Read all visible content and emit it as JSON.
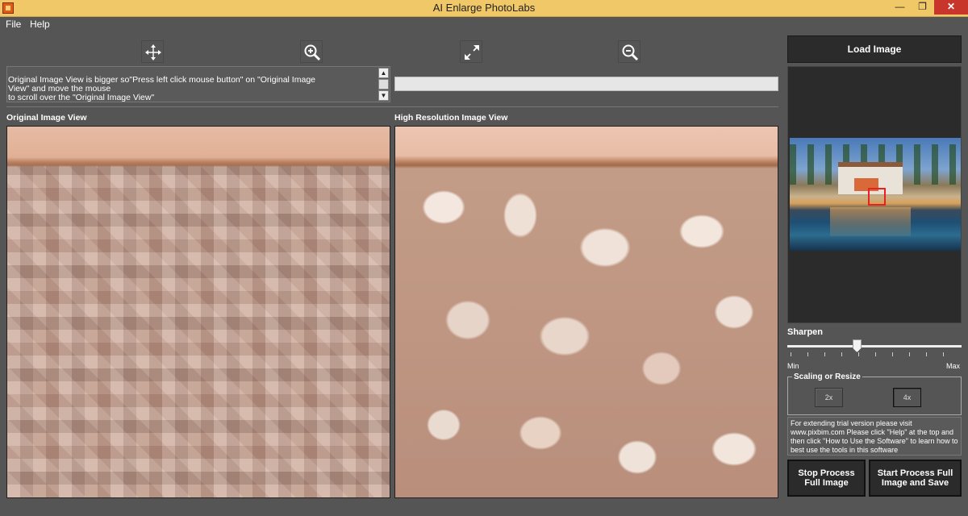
{
  "window": {
    "title": "AI Enlarge PhotoLabs",
    "min_glyph": "—",
    "max_glyph": "❐",
    "close_glyph": "✕"
  },
  "menu": [
    {
      "label": "File"
    },
    {
      "label": "Help"
    }
  ],
  "toolbar": {
    "icons": [
      "move-icon",
      "zoom-in-icon",
      "fit-expand-icon",
      "zoom-out-icon"
    ]
  },
  "info": {
    "text": "Original Image View is bigger so\"Press left click mouse button\" on \"Original Image\nView\" and move the mouse\nto scroll over the \"Original Image View\"",
    "scroll_up": "▲",
    "scroll_down": "▼"
  },
  "progress": {
    "value": 0
  },
  "views": {
    "original_label": "Original Image View",
    "hires_label": "High Resolution Image View"
  },
  "right_panel": {
    "load_button": "Load Image",
    "sharpen_label": "Sharpen",
    "sharpen_min": "Min",
    "sharpen_max": "Max",
    "sharpen_level": 0.4,
    "scaling_label": "Scaling or Resize",
    "scale_2x": "2x",
    "scale_4x": "4x",
    "selected_scale": "4x",
    "trial_text": "For extending trial version please visit www.pixbim.com Please click \"Help\" at the top and then click  \"How to Use the Software\" to learn how to best use the tools in this software",
    "stop_button": "Stop Process\nFull Image",
    "start_button": "Start Process Full\nImage and Save"
  },
  "colors": {
    "titlebar": "#f0c868",
    "background": "#555555",
    "dark_button": "#2b2b2b",
    "close": "#c7352b",
    "selection_box": "#e82020"
  }
}
